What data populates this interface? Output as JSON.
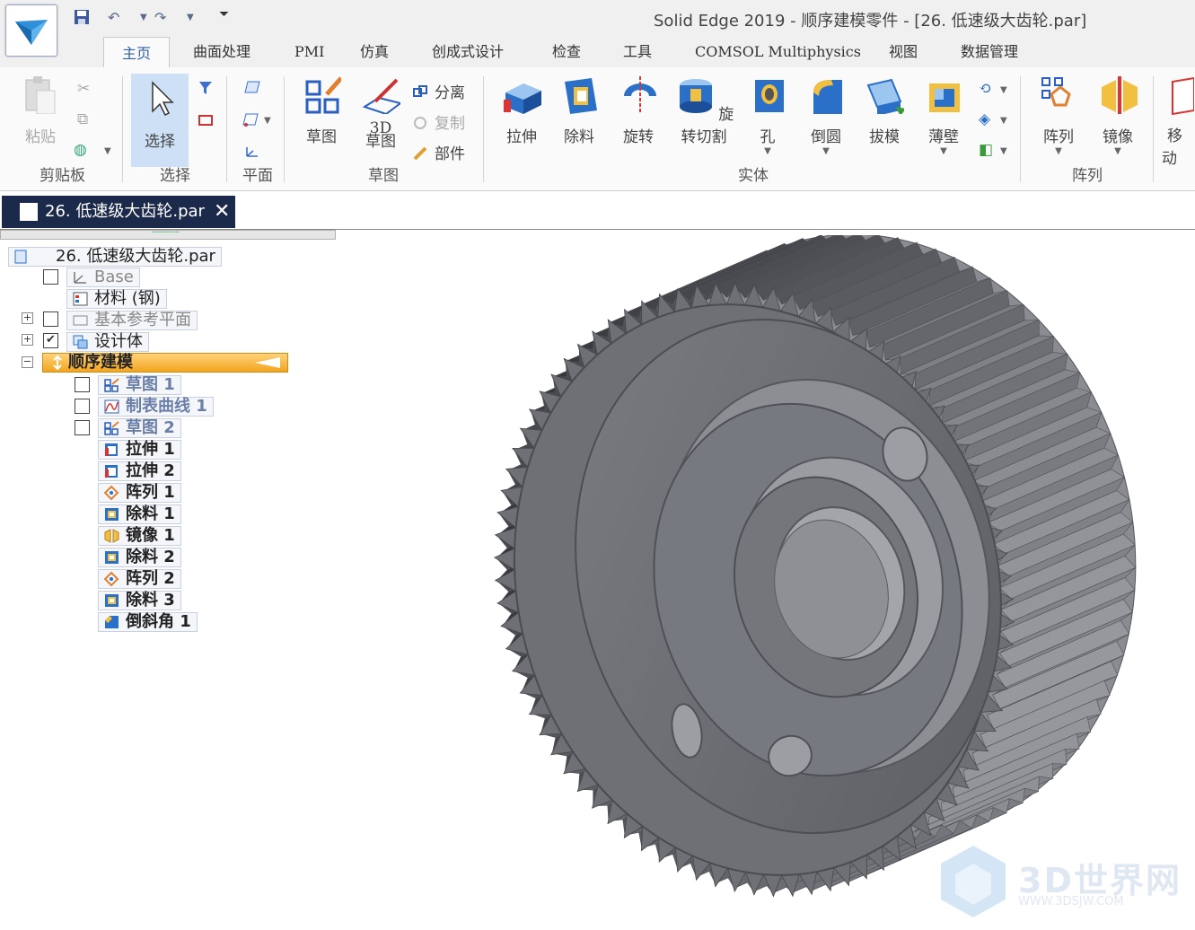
{
  "window": {
    "title": "Solid Edge 2019 - 顺序建模零件 - [26. 低速级大齿轮.par]"
  },
  "tabs": [
    {
      "label": "主页"
    },
    {
      "label": "曲面处理"
    },
    {
      "label": "PMI"
    },
    {
      "label": "仿真"
    },
    {
      "label": "创成式设计"
    },
    {
      "label": "检查"
    },
    {
      "label": "工具"
    },
    {
      "label": "COMSOL Multiphysics"
    },
    {
      "label": "视图"
    },
    {
      "label": "数据管理"
    }
  ],
  "ribbon": {
    "clipboard": {
      "paste": "粘贴",
      "group": "剪贴板"
    },
    "select": {
      "select": "选择",
      "group": "选择"
    },
    "plane": {
      "group": "平面"
    },
    "sketch": {
      "sketch": "草图",
      "sketch3d_a": "3D",
      "sketch3d_b": "草图",
      "group": "草图",
      "separate": "分离",
      "copy": "复制",
      "part": "部件"
    },
    "solid": {
      "extrude": "拉伸",
      "cutout": "除料",
      "revolve": "旋转",
      "revolve_cut": "旋转切割",
      "hole": "孔",
      "round": "倒圆",
      "draft": "拔模",
      "thin_wall": "薄壁",
      "group": "实体"
    },
    "pattern": {
      "pattern": "阵列",
      "mirror": "镜像",
      "group": "阵列"
    },
    "move": {
      "move": "移动"
    }
  },
  "document_tab": {
    "label": "26. 低速级大齿轮.par",
    "close": "✕"
  },
  "tree": {
    "root": "26. 低速级大齿轮.par",
    "base": "Base",
    "material": "材料 (钢)",
    "ref_planes": "基本参考平面",
    "design_body": "设计体",
    "sequential": "顺序建模",
    "features": [
      {
        "label": "草图 1",
        "icon": "sketch-icon"
      },
      {
        "label": "制表曲线 1",
        "icon": "table-curve-icon"
      },
      {
        "label": "草图 2",
        "icon": "sketch-icon"
      },
      {
        "label": "拉伸 1",
        "icon": "extrude-icon"
      },
      {
        "label": "拉伸 2",
        "icon": "extrude-icon"
      },
      {
        "label": "阵列 1",
        "icon": "pattern-icon"
      },
      {
        "label": "除料 1",
        "icon": "cutout-icon"
      },
      {
        "label": "镜像 1",
        "icon": "mirror-icon"
      },
      {
        "label": "除料 2",
        "icon": "cutout-icon"
      },
      {
        "label": "阵列 2",
        "icon": "pattern-icon"
      },
      {
        "label": "除料 3",
        "icon": "cutout-icon"
      },
      {
        "label": "倒斜角 1",
        "icon": "chamfer-icon"
      }
    ]
  },
  "watermark": {
    "text": "3D世界网",
    "sub": "WWW.3DSJW.COM"
  },
  "colors": {
    "accent": "#3060a8",
    "selection": "#f3a51e",
    "gear": "#6b6d73",
    "doctab": "#1b2a4a"
  }
}
